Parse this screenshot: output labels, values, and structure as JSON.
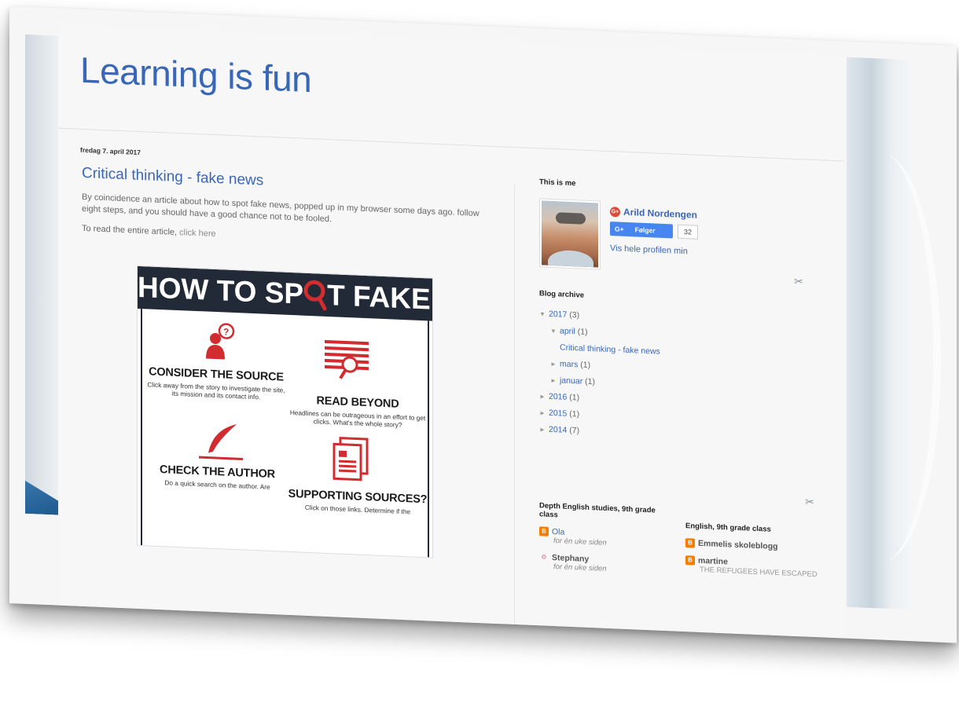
{
  "blog": {
    "title": "Learning is fun"
  },
  "post": {
    "date": "fredag 7. april 2017",
    "title": "Critical thinking - fake news",
    "body": "By coincidence an article about how to spot fake news, popped up in my browser some days ago. follow eight steps, and you should have a good chance not to be fooled.",
    "read_prefix": "To read the entire article,",
    "read_link": "click here"
  },
  "infographic": {
    "banner_part1": "HOW TO SP",
    "banner_part2": "T FAKE NEWS",
    "accent_color": "#d12c30",
    "cards": [
      {
        "title": "CONSIDER THE SOURCE",
        "desc": "Click away from the story to investigate the site, its mission and its contact info."
      },
      {
        "title": "READ BEYOND",
        "desc": "Headlines can be outrageous in an effort to get clicks. What's the whole story?"
      },
      {
        "title": "CHECK THE AUTHOR",
        "desc": "Do a quick search on the author. Are"
      },
      {
        "title": "SUPPORTING SOURCES?",
        "desc": "Click on those links. Determine if the"
      }
    ]
  },
  "sidebar": {
    "profile": {
      "heading": "This is me",
      "name": "Arild Nordengen",
      "gplus_label": "G+",
      "follow_label": "Følger",
      "follow_count": "32",
      "profile_link": "Vis hele profilen min"
    },
    "archive": {
      "heading": "Blog archive",
      "items": [
        {
          "toggle": "▼",
          "label": "2017",
          "count": "(3)",
          "level": 0
        },
        {
          "toggle": "▼",
          "label": "april",
          "count": "(1)",
          "level": 1
        },
        {
          "toggle": "",
          "label": "Critical thinking - fake news",
          "count": "",
          "level": 2
        },
        {
          "toggle": "►",
          "label": "mars",
          "count": "(1)",
          "level": 1
        },
        {
          "toggle": "►",
          "label": "januar",
          "count": "(1)",
          "level": 1
        },
        {
          "toggle": "►",
          "label": "2016",
          "count": "(1)",
          "level": 0
        },
        {
          "toggle": "►",
          "label": "2015",
          "count": "(1)",
          "level": 0
        },
        {
          "toggle": "►",
          "label": "2014",
          "count": "(7)",
          "level": 0
        }
      ]
    },
    "bloglist_left": {
      "heading": "Depth English studies, 9th grade class",
      "items": [
        {
          "name": "Ola",
          "sub": "for én uke siden"
        },
        {
          "name": "Stephany",
          "sub": "for én uke siden"
        }
      ]
    },
    "bloglist_right": {
      "heading": "English, 9th grade class",
      "items": [
        {
          "name": "Emmelis skoleblogg",
          "sub": ""
        },
        {
          "name": "martine",
          "sub": "THE REFUGEES HAVE ESCAPED"
        }
      ]
    },
    "tools_icon": "wrench-screwdriver-icon"
  },
  "colors": {
    "link_blue": "#3967b8",
    "banner_dark": "#222a38",
    "blogger_orange": "#f57d00",
    "gplus_red": "#dd4b39",
    "follow_blue": "#4785f1"
  }
}
